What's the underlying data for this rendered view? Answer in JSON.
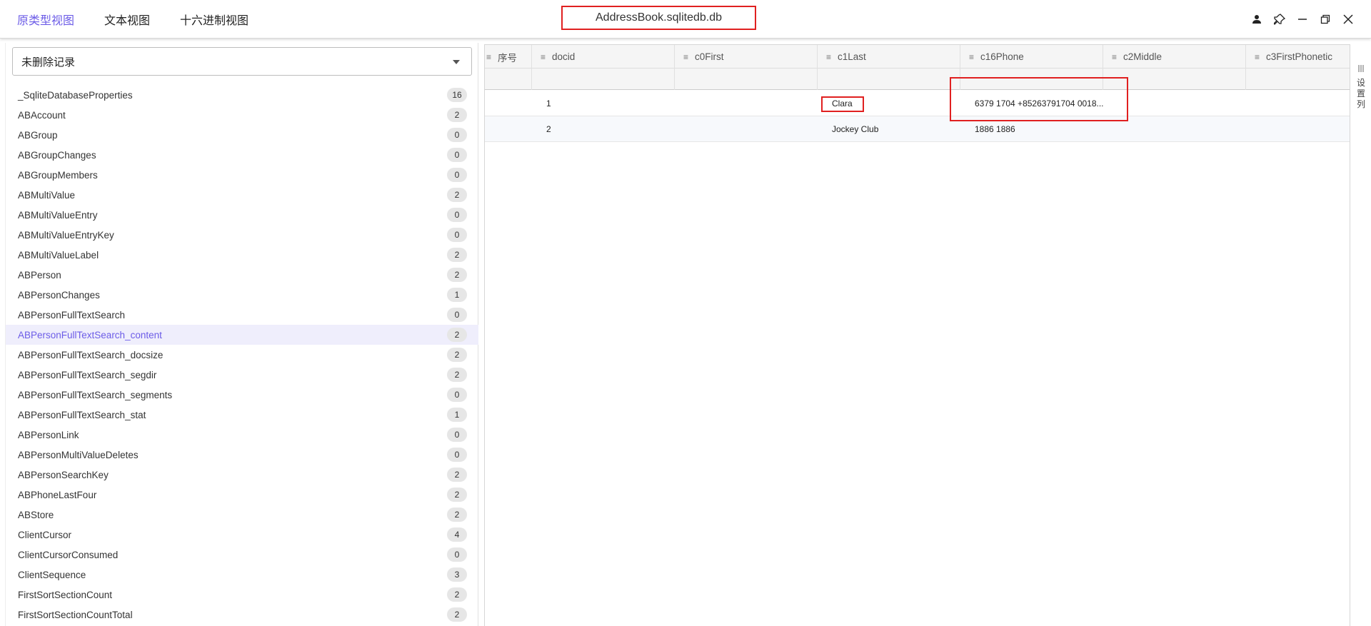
{
  "header": {
    "tabs": [
      {
        "label": "原类型视图",
        "active": true
      },
      {
        "label": "文本视图",
        "active": false
      },
      {
        "label": "十六进制视图",
        "active": false
      }
    ],
    "file_title": "AddressBook.sqlitedb.db",
    "window_icons": [
      "user-icon",
      "pin-icon",
      "minimize-icon",
      "restore-icon",
      "close-icon"
    ]
  },
  "left_panel": {
    "filter_value": "未删除记录",
    "tables": [
      {
        "name": "_SqliteDatabaseProperties",
        "count": "16"
      },
      {
        "name": "ABAccount",
        "count": "2"
      },
      {
        "name": "ABGroup",
        "count": "0"
      },
      {
        "name": "ABGroupChanges",
        "count": "0"
      },
      {
        "name": "ABGroupMembers",
        "count": "0"
      },
      {
        "name": "ABMultiValue",
        "count": "2"
      },
      {
        "name": "ABMultiValueEntry",
        "count": "0"
      },
      {
        "name": "ABMultiValueEntryKey",
        "count": "0"
      },
      {
        "name": "ABMultiValueLabel",
        "count": "2"
      },
      {
        "name": "ABPerson",
        "count": "2"
      },
      {
        "name": "ABPersonChanges",
        "count": "1"
      },
      {
        "name": "ABPersonFullTextSearch",
        "count": "0"
      },
      {
        "name": "ABPersonFullTextSearch_content",
        "count": "2",
        "selected": true
      },
      {
        "name": "ABPersonFullTextSearch_docsize",
        "count": "2"
      },
      {
        "name": "ABPersonFullTextSearch_segdir",
        "count": "2"
      },
      {
        "name": "ABPersonFullTextSearch_segments",
        "count": "0"
      },
      {
        "name": "ABPersonFullTextSearch_stat",
        "count": "1"
      },
      {
        "name": "ABPersonLink",
        "count": "0"
      },
      {
        "name": "ABPersonMultiValueDeletes",
        "count": "0"
      },
      {
        "name": "ABPersonSearchKey",
        "count": "2"
      },
      {
        "name": "ABPhoneLastFour",
        "count": "2"
      },
      {
        "name": "ABStore",
        "count": "2"
      },
      {
        "name": "ClientCursor",
        "count": "4"
      },
      {
        "name": "ClientCursorConsumed",
        "count": "0"
      },
      {
        "name": "ClientSequence",
        "count": "3"
      },
      {
        "name": "FirstSortSectionCount",
        "count": "2"
      },
      {
        "name": "FirstSortSectionCountTotal",
        "count": "2"
      }
    ]
  },
  "grid": {
    "columns": [
      "序号",
      "docid",
      "c0First",
      "c1Last",
      "c16Phone",
      "c2Middle",
      "c3FirstPhonetic"
    ],
    "rows": [
      {
        "docid": "1",
        "c1Last": "Clara",
        "c16Phone": "6379 1704 +85263791704 0018..."
      },
      {
        "docid": "2",
        "c1Last": "Jockey Club",
        "c16Phone": "1886 1886"
      }
    ]
  },
  "side_panel": {
    "label_chars": [
      "设",
      "置",
      "列"
    ]
  },
  "colors": {
    "accent": "#6c5ce7",
    "highlight": "#e02020"
  }
}
